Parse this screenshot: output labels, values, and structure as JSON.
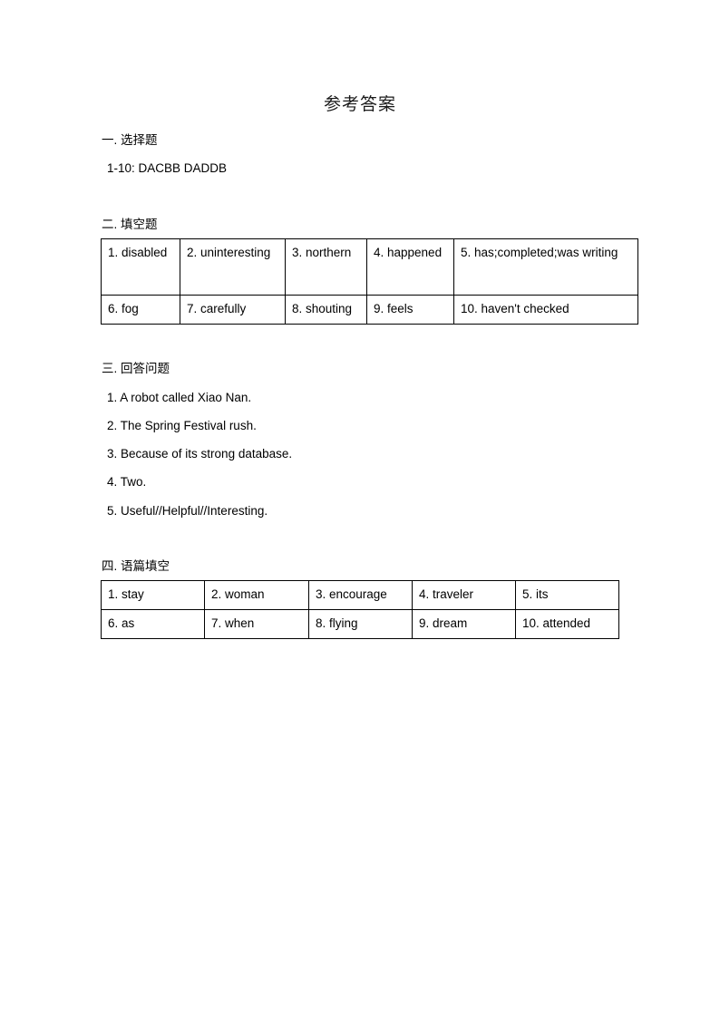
{
  "document": {
    "title": "参考答案"
  },
  "sections": [
    {
      "marker": "一.",
      "label": "选择题",
      "heading": "一.  选择题",
      "lines": [
        "1-10: DACBB DADDB"
      ]
    },
    {
      "marker": "二.",
      "label": "填空题",
      "heading": "二.  填空题"
    },
    {
      "marker": "三.",
      "label": "回答问题",
      "heading": "三.  回答问题",
      "lines": [
        "1. A robot called Xiao Nan.",
        "2. The Spring Festival rush.",
        "3. Because of its strong database.",
        "4. Two.",
        "5. Useful//Helpful//Interesting."
      ]
    },
    {
      "marker": "四.",
      "label": "语篇填空",
      "heading": "四.  语篇填空"
    }
  ],
  "fill_blanks_table": {
    "rows": [
      [
        "1. disabled",
        "2. uninteresting",
        "3. northern",
        "4. happened",
        "5. has;completed;was writing"
      ],
      [
        "6. fog",
        "7. carefully",
        "8. shouting",
        "9. feels",
        "10. haven't checked"
      ]
    ]
  },
  "passage_blanks_table": {
    "rows": [
      [
        "1. stay",
        "2. woman",
        "3. encourage",
        "4. traveler",
        "5. its"
      ],
      [
        "6. as",
        "7. when",
        "8. flying",
        "9. dream",
        "10. attended"
      ]
    ]
  },
  "colors": {
    "text": "#000000",
    "title": "#1a1a1a",
    "border": "#000000",
    "background": "#ffffff"
  }
}
